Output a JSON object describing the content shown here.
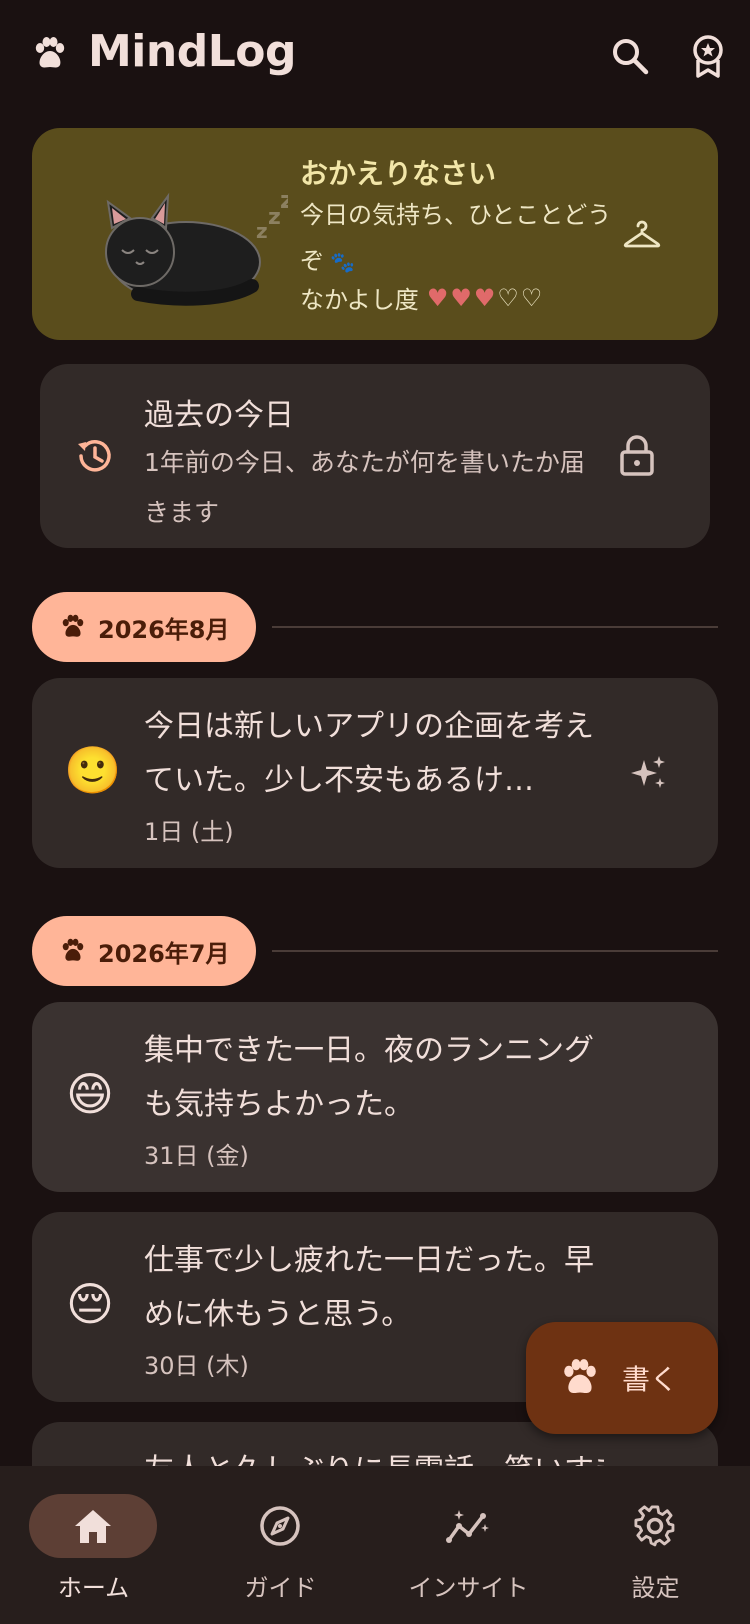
{
  "app": {
    "title": "MindLog"
  },
  "welcome": {
    "title": "おかえりなさい",
    "message": "今日の気持ち、ひとことどうぞ",
    "friendship_label": "なかよし度",
    "friendship_level": 3,
    "friendship_max": 5,
    "sleep_text": "zzz"
  },
  "past_today": {
    "title": "過去の今日",
    "description": "1年前の今日、あなたが何を書いたか届きます"
  },
  "sections": [
    {
      "month": "2026年8月",
      "entries": [
        {
          "mood": "🙂",
          "text": "今日は新しいアプリの企画を考えていた。少し不安もあるけ…",
          "date": "1日 (土)"
        }
      ]
    },
    {
      "month": "2026年7月",
      "entries": [
        {
          "mood": "😄",
          "text": "集中できた一日。夜のランニングも気持ちよかった。",
          "date": "31日 (金)"
        },
        {
          "mood": "😔",
          "text": "仕事で少し疲れた一日だった。早めに休もうと思う。",
          "date": "30日 (木)"
        },
        {
          "text": "友人と久しぶりに長電話。笑いすぎ"
        }
      ]
    }
  ],
  "fab": {
    "label": "書く"
  },
  "nav": [
    {
      "label": "ホーム",
      "icon": "home-icon"
    },
    {
      "label": "ガイド",
      "icon": "compass-icon"
    },
    {
      "label": "インサイト",
      "icon": "insights-icon"
    },
    {
      "label": "設定",
      "icon": "gear-icon"
    }
  ],
  "colors": {
    "background": "#1a1111",
    "welcome_card": "#5a4d1c",
    "card": "#322a28",
    "month_pill": "#ffb598",
    "fab": "#6e3212",
    "nav_active": "#5d3f35",
    "heart": "#e06a6a"
  }
}
